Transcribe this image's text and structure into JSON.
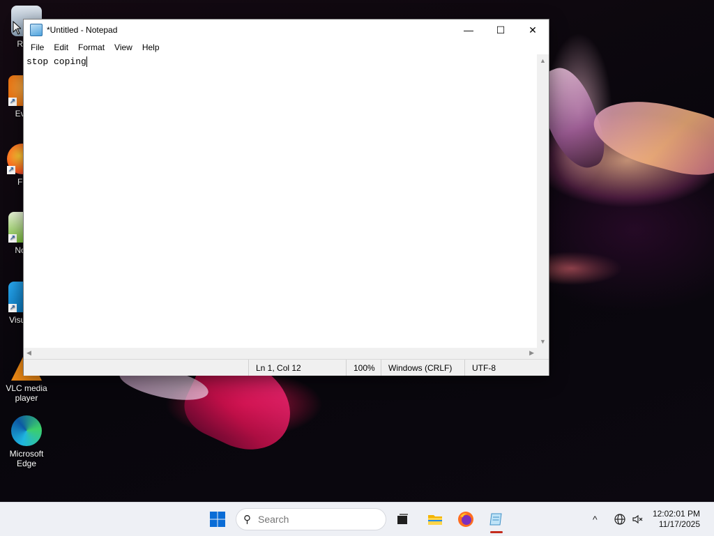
{
  "desktop": {
    "icons": [
      {
        "label": "Recy"
      },
      {
        "label": "Ever"
      },
      {
        "label": "Fir"
      },
      {
        "label": "Note"
      },
      {
        "label": "Visua C"
      },
      {
        "label": "VLC media player"
      },
      {
        "label": "Microsoft Edge"
      }
    ]
  },
  "notepad": {
    "title": "*Untitled - Notepad",
    "controls": {
      "minimize": "—",
      "maximize": "☐",
      "close": "✕"
    },
    "menu": [
      "File",
      "Edit",
      "Format",
      "View",
      "Help"
    ],
    "content": "stop coping",
    "status": {
      "position": "Ln 1, Col 12",
      "zoom": "100%",
      "line_ending": "Windows (CRLF)",
      "encoding": "UTF-8"
    }
  },
  "taskbar": {
    "search_placeholder": "Search",
    "apps": [
      "start-icon",
      "task-view-icon",
      "file-explorer-icon",
      "firefox-icon",
      "notepad-icon"
    ],
    "tray": {
      "chevron": "^"
    },
    "clock": {
      "time": "12:02:01 PM",
      "date": "11/17/2025"
    }
  },
  "colors": {
    "taskbar_bg": "#eef0f5",
    "active_indicator": "#c42b1c",
    "start_blue": "#0a6cd6"
  }
}
